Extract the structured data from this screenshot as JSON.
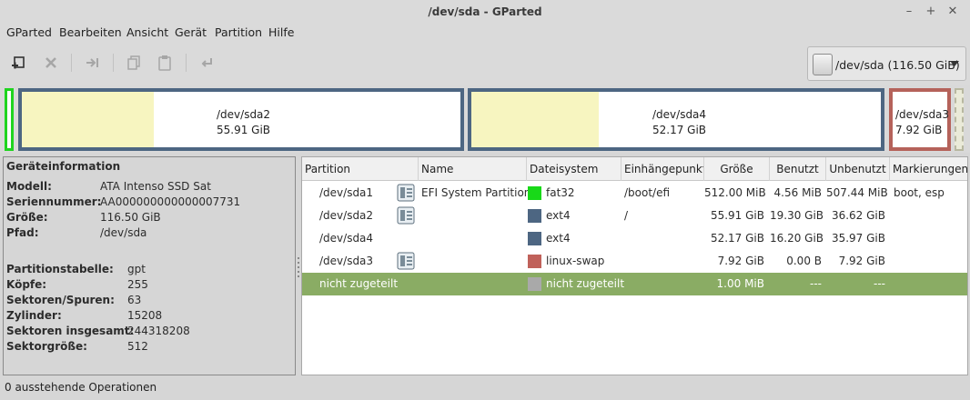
{
  "window": {
    "title": "/dev/sda - GParted",
    "minimize": "–",
    "maximize": "+",
    "close": "✕"
  },
  "menu": [
    "GParted",
    "Bearbeiten",
    "Ansicht",
    "Gerät",
    "Partition",
    "Hilfe"
  ],
  "toolbar": {
    "icons": [
      "new-partition-icon",
      "delete-icon",
      "resize-move-icon",
      "copy-icon",
      "paste-icon",
      "undo-icon"
    ],
    "device_selector": "/dev/sda   (116.50 GiB)"
  },
  "diskmap": {
    "partitions": [
      {
        "name": "/dev/sda2",
        "size": "55.91 GiB",
        "used_fraction": 0.3,
        "color": "#4d6682"
      },
      {
        "name": "/dev/sda4",
        "size": "52.17 GiB",
        "used_fraction": 0.31,
        "color": "#4d6682"
      },
      {
        "name": "/dev/sda3",
        "size": "7.92 GiB",
        "used_fraction": 0.0,
        "color": "#b5625a"
      }
    ]
  },
  "info": {
    "header": "Geräteinformation",
    "device": [
      {
        "label": "Modell:",
        "value": "ATA Intenso SSD Sat"
      },
      {
        "label": "Seriennummer:",
        "value": "AA000000000000007731"
      },
      {
        "label": "Größe:",
        "value": "116.50 GiB"
      },
      {
        "label": "Pfad:",
        "value": "/dev/sda"
      }
    ],
    "table": [
      {
        "label": "Partitionstabelle:",
        "value": "gpt"
      },
      {
        "label": "Köpfe:",
        "value": "255"
      },
      {
        "label": "Sektoren/Spuren:",
        "value": "63"
      },
      {
        "label": "Zylinder:",
        "value": "15208"
      },
      {
        "label": "Sektoren insgesamt:",
        "value": "244318208"
      },
      {
        "label": "Sektorgröße:",
        "value": "512"
      }
    ]
  },
  "partitions_table": {
    "columns": [
      "Partition",
      "Name",
      "Dateisystem",
      "Einhängepunkt",
      "Größe",
      "Benutzt",
      "Unbenutzt",
      "Markierungen"
    ],
    "rows": [
      {
        "partition": "/dev/sda1",
        "locked": true,
        "name": "EFI System Partition",
        "fs": "fat32",
        "fs_color": "#18d918",
        "mount": "/boot/efi",
        "size": "512.00 MiB",
        "used": "4.56 MiB",
        "unused": "507.44 MiB",
        "flags": "boot, esp"
      },
      {
        "partition": "/dev/sda2",
        "locked": true,
        "name": "",
        "fs": "ext4",
        "fs_color": "#4d6682",
        "mount": "/",
        "size": "55.91 GiB",
        "used": "19.30 GiB",
        "unused": "36.62 GiB",
        "flags": ""
      },
      {
        "partition": "/dev/sda4",
        "locked": false,
        "name": "",
        "fs": "ext4",
        "fs_color": "#4d6682",
        "mount": "",
        "size": "52.17 GiB",
        "used": "16.20 GiB",
        "unused": "35.97 GiB",
        "flags": ""
      },
      {
        "partition": "/dev/sda3",
        "locked": true,
        "name": "",
        "fs": "linux-swap",
        "fs_color": "#c0615a",
        "mount": "",
        "size": "7.92 GiB",
        "used": "0.00 B",
        "unused": "7.92 GiB",
        "flags": ""
      },
      {
        "partition": "nicht zugeteilt",
        "locked": false,
        "name": "",
        "fs": "nicht zugeteilt",
        "fs_color": "#a9a9a9",
        "mount": "",
        "size": "1.00 MiB",
        "used": "---",
        "unused": "---",
        "flags": "",
        "selected": true
      }
    ]
  },
  "status": {
    "text": "0 ausstehende Operationen"
  }
}
